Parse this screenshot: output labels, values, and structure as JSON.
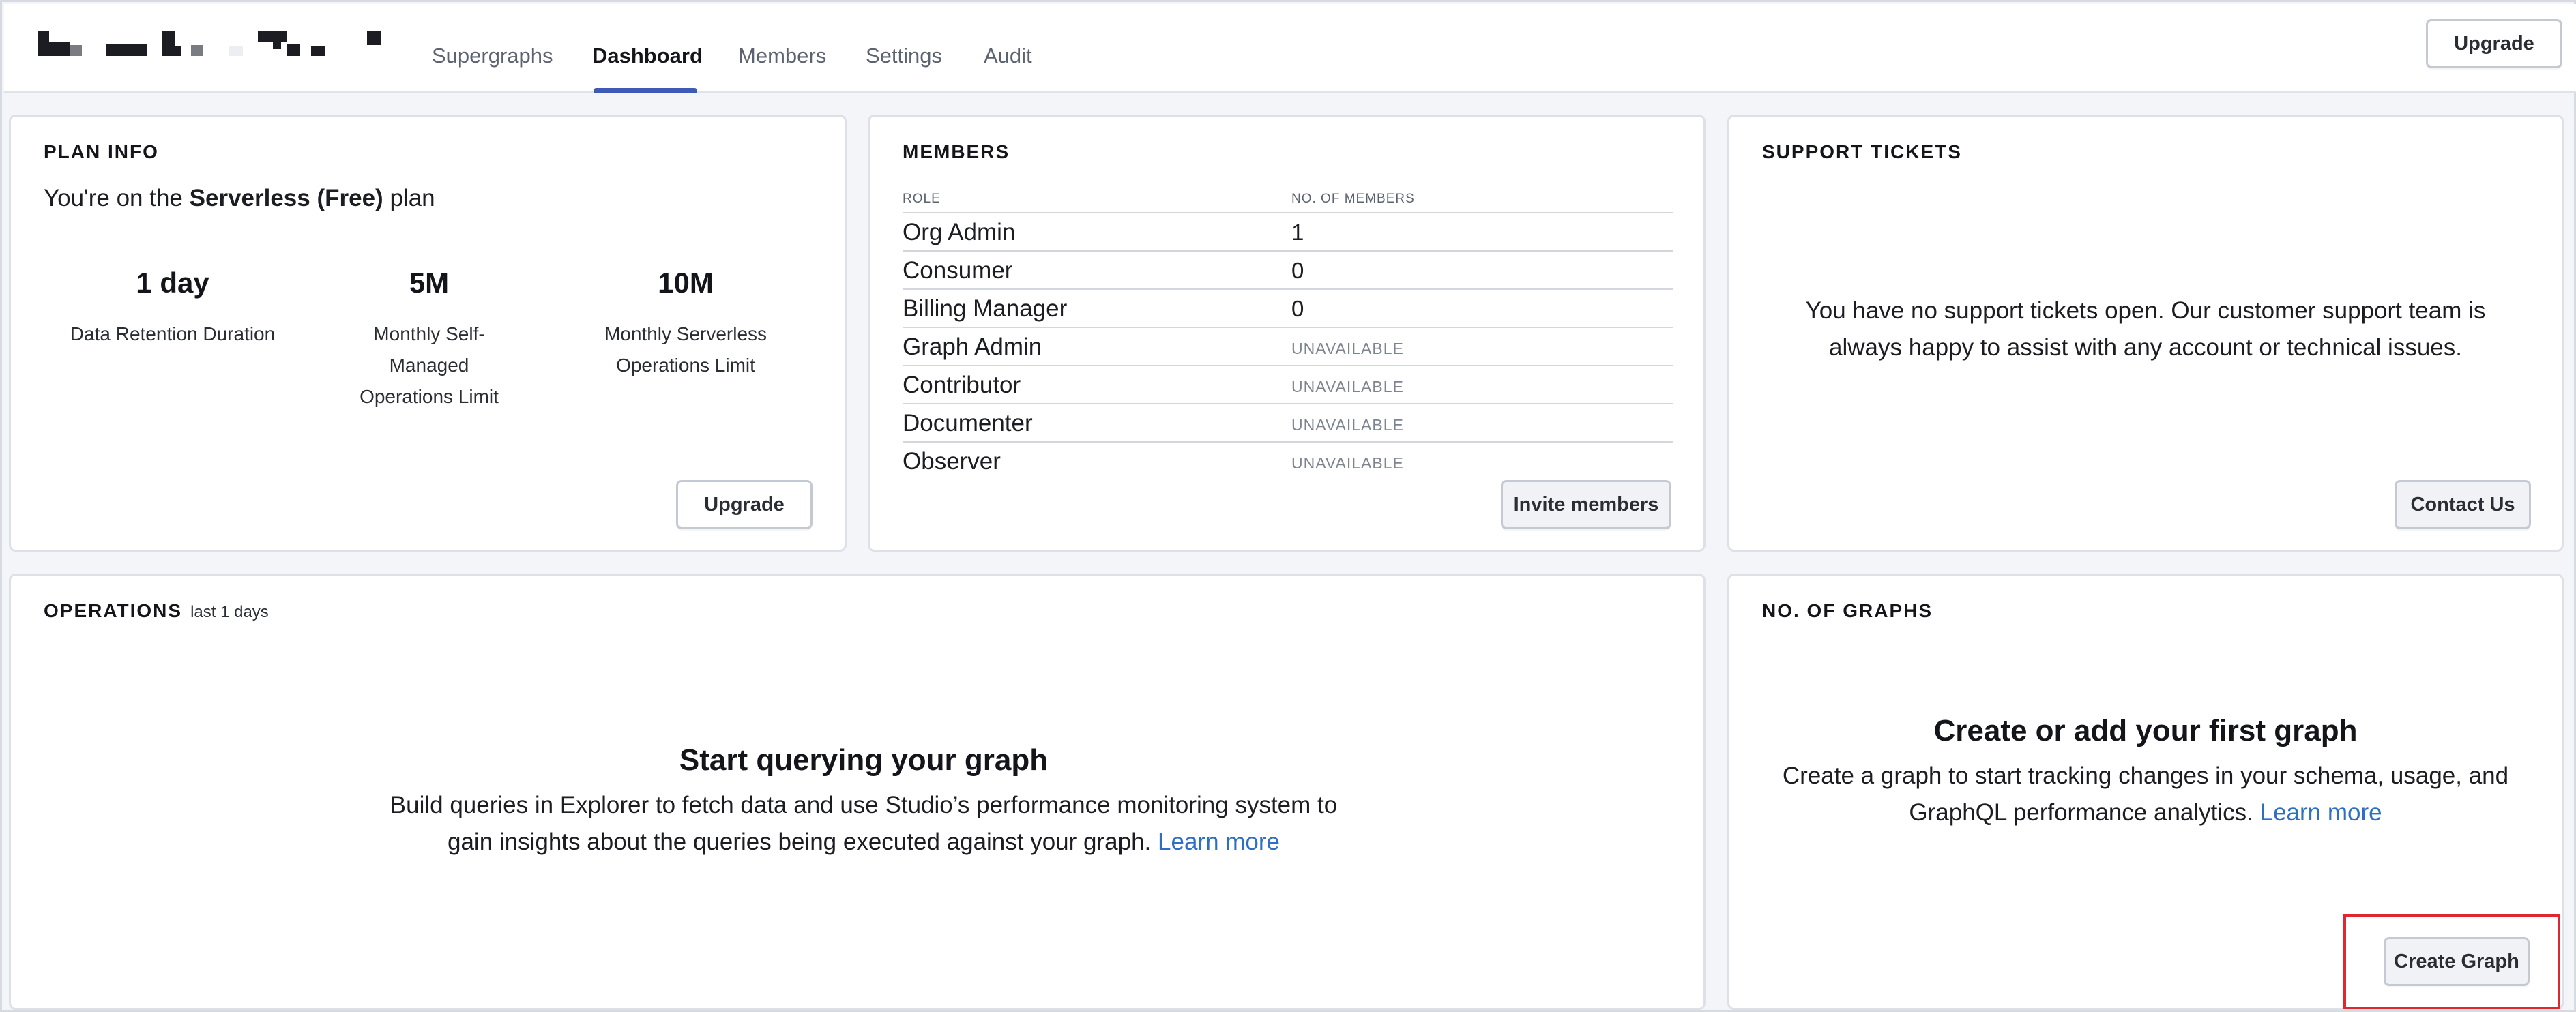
{
  "header": {
    "tabs": [
      {
        "label": "Supergraphs"
      },
      {
        "label": "Dashboard"
      },
      {
        "label": "Members"
      },
      {
        "label": "Settings"
      },
      {
        "label": "Audit"
      }
    ],
    "active_tab": "Dashboard",
    "upgrade_label": "Upgrade"
  },
  "plan_info": {
    "title": "PLAN INFO",
    "plan_prefix": "You're on the",
    "plan_name": "Serverless (Free)",
    "plan_suffix": "plan",
    "stats": [
      {
        "value": "1 day",
        "label": "Data Retention Duration"
      },
      {
        "value": "5M",
        "label": "Monthly Self-Managed Operations Limit"
      },
      {
        "value": "10M",
        "label": "Monthly Serverless Operations Limit"
      }
    ],
    "upgrade_label": "Upgrade"
  },
  "members": {
    "title": "MEMBERS",
    "col_role": "ROLE",
    "col_count": "NO. OF MEMBERS",
    "rows": [
      {
        "role": "Org Admin",
        "count": "1"
      },
      {
        "role": "Consumer",
        "count": "0"
      },
      {
        "role": "Billing Manager",
        "count": "0"
      },
      {
        "role": "Graph Admin",
        "count": "UNAVAILABLE"
      },
      {
        "role": "Contributor",
        "count": "UNAVAILABLE"
      },
      {
        "role": "Documenter",
        "count": "UNAVAILABLE"
      },
      {
        "role": "Observer",
        "count": "UNAVAILABLE"
      }
    ],
    "invite_label": "Invite members"
  },
  "support": {
    "title": "SUPPORT TICKETS",
    "message": "You have no support tickets open. Our customer support team is always happy to assist with any account or technical issues.",
    "contact_label": "Contact Us"
  },
  "operations": {
    "title": "OPERATIONS",
    "range_note": "last 1 days",
    "empty_title": "Start querying your graph",
    "empty_body": "Build queries in Explorer to fetch data and use Studio’s performance monitoring system to gain insights about the queries being executed against your graph.",
    "learn_more": "Learn more"
  },
  "graphs": {
    "title": "NO. OF GRAPHS",
    "empty_title": "Create or add your first graph",
    "empty_body": "Create a graph to start tracking changes in your schema, usage, and GraphQL performance analytics.",
    "learn_more": "Learn more",
    "create_label": "Create Graph"
  },
  "colors": {
    "accent": "#3f5ab4",
    "link": "#2d6fc4",
    "highlight": "#e0262f"
  }
}
